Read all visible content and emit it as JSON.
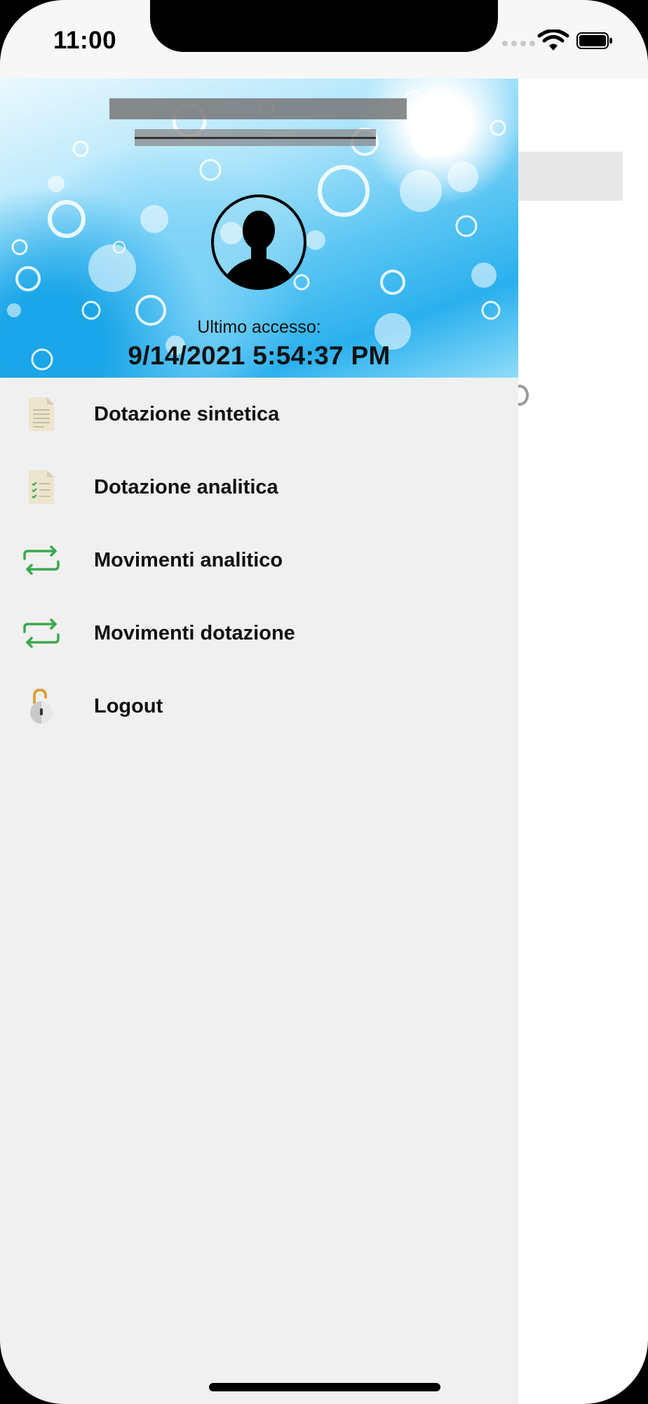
{
  "status_bar": {
    "time": "11:00"
  },
  "header": {
    "last_access_label": "Ultimo accesso:",
    "last_access_value": "9/14/2021 5:54:37 PM"
  },
  "menu": {
    "items": [
      {
        "label": "Dotazione sintetica",
        "icon": "document-icon"
      },
      {
        "label": "Dotazione analitica",
        "icon": "checklist-document-icon"
      },
      {
        "label": "Movimenti analitico",
        "icon": "swap-arrows-icon"
      },
      {
        "label": "Movimenti dotazione",
        "icon": "swap-arrows-icon"
      },
      {
        "label": "Logout",
        "icon": "unlocked-padlock-icon"
      }
    ]
  },
  "colors": {
    "drawer_background": "#f0f0f0",
    "arrow_green": "#3aa84b",
    "document_beige": "#ece6cf",
    "padlock_gold": "#d9a13a"
  }
}
